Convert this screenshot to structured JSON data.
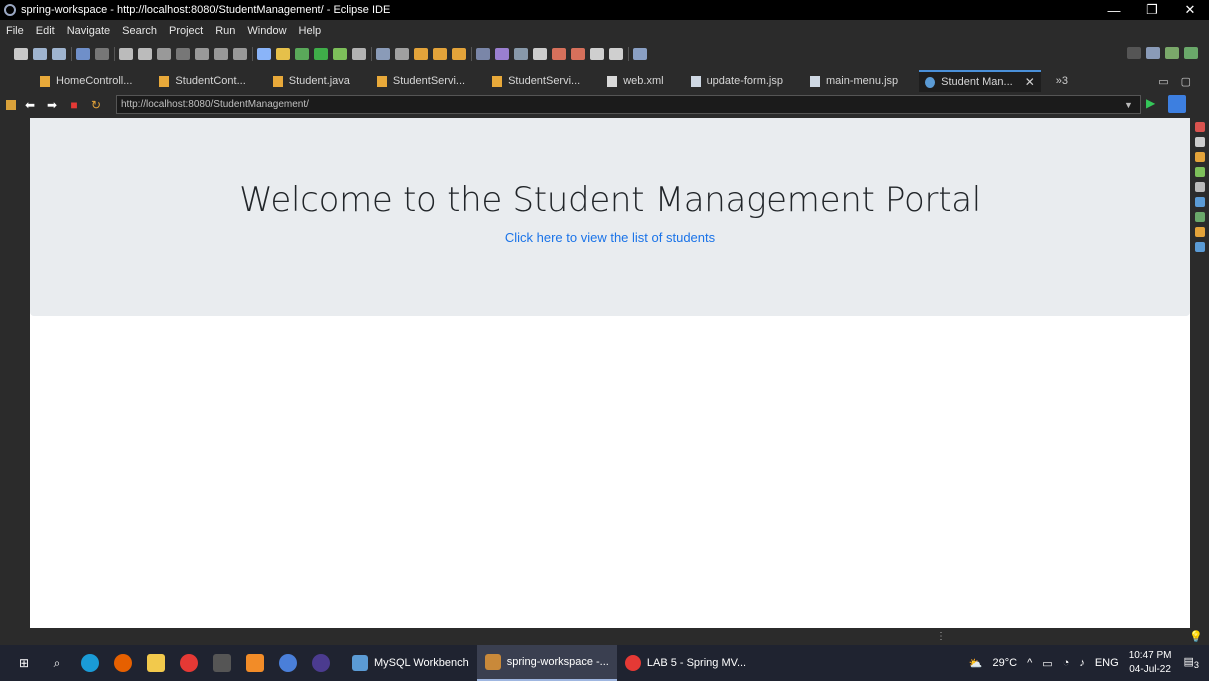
{
  "window": {
    "title": "spring-workspace - http://localhost:8080/StudentManagement/ - Eclipse IDE"
  },
  "menu": [
    "File",
    "Edit",
    "Navigate",
    "Search",
    "Project",
    "Run",
    "Window",
    "Help"
  ],
  "tabs": [
    {
      "label": "HomeControll...",
      "icon": "java-file-icon"
    },
    {
      "label": "StudentCont...",
      "icon": "java-file-icon"
    },
    {
      "label": "Student.java",
      "icon": "java-file-icon"
    },
    {
      "label": "StudentServi...",
      "icon": "java-file-icon"
    },
    {
      "label": "StudentServi...",
      "icon": "java-file-icon"
    },
    {
      "label": "web.xml",
      "icon": "xml-file-icon"
    },
    {
      "label": "update-form.jsp",
      "icon": "jsp-file-icon"
    },
    {
      "label": "main-menu.jsp",
      "icon": "jsp-file-icon"
    },
    {
      "label": "Student Man...",
      "icon": "web-browser-icon",
      "active": true
    }
  ],
  "tabs_overflow": "»3",
  "browser": {
    "url": "http://localhost:8080/StudentManagement/"
  },
  "page": {
    "heading": "Welcome to the Student Management Portal",
    "link": "Click here to view the list of students"
  },
  "taskbar": {
    "apps": [
      {
        "label": "MySQL Workbench",
        "icon": "mysql-workbench-icon"
      },
      {
        "label": "spring-workspace -...",
        "icon": "eclipse-icon",
        "active": true
      },
      {
        "label": "LAB 5 - Spring MV...",
        "icon": "chrome-icon"
      }
    ],
    "weather": "29°C",
    "language": "ENG",
    "time": "10:47 PM",
    "date": "04-Jul-22",
    "notification_count": "3"
  },
  "colors": {
    "link": "#1a73e8",
    "jumbotron": "#e9ecef",
    "heading": "#212529"
  }
}
